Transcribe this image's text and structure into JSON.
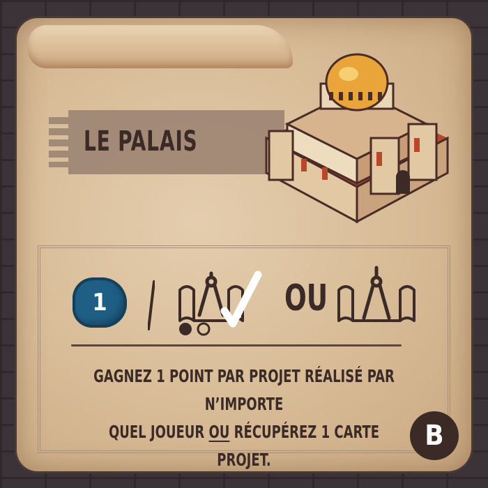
{
  "card": {
    "title": "LE PALAIS",
    "token_value": "1",
    "separator": "OU",
    "description_line1": "GAGNEZ 1 POINT PAR PROJET RÉALISÉ PAR N’IMPORTE",
    "description_line2_part1": "QUEL JOUEUR ",
    "description_line2_underlined": "OU",
    "description_line2_part2": " RÉCUPÉREZ 1 CARTE PROJET.",
    "badge": "B"
  },
  "colors": {
    "token_blue": "#1f5f86",
    "ink": "#3b2a26",
    "parchment": "#d7bb96",
    "palace_gold": "#e9a53a"
  },
  "icons": [
    "palace-illustration",
    "project-scroll-icon",
    "check-icon",
    "compass-icon"
  ]
}
